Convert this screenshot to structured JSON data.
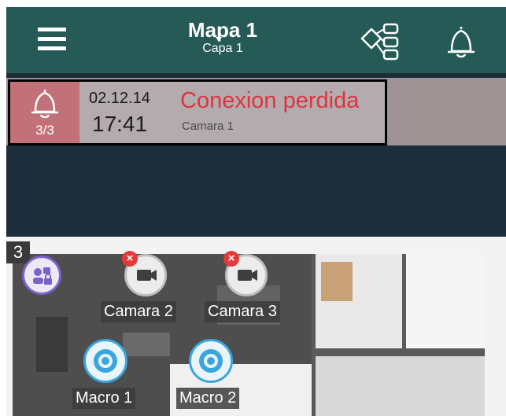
{
  "header": {
    "title": "Mapa 1",
    "subtitle": "Capa 1"
  },
  "alarm": {
    "count": "3/3",
    "date": "02.12.14",
    "time": "17:41",
    "message": "Conexion perdida",
    "source": "Camara 1"
  },
  "map": {
    "layer_number": "3",
    "cameras": [
      {
        "label": "Camara 2",
        "status": "error"
      },
      {
        "label": "Camara 3",
        "status": "error"
      }
    ],
    "macros": [
      {
        "label": "Macro 1"
      },
      {
        "label": "Macro 2"
      }
    ]
  },
  "colors": {
    "header_bg": "#255a57",
    "alarm_text": "#e0333f",
    "macro_accent": "#3aa6dd",
    "lock_accent": "#7b61c9"
  }
}
